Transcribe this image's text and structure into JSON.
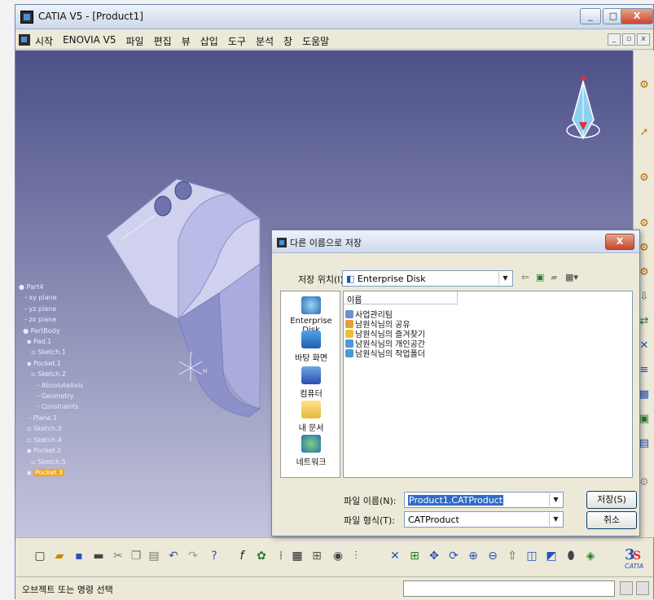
{
  "window": {
    "title": "CATIA V5 - [Product1]",
    "controls": {
      "minimize": "_",
      "maximize": "□",
      "close": "X"
    }
  },
  "menu": {
    "items": [
      "시작",
      "ENOVIA V5",
      "파일",
      "편집",
      "뷰",
      "삽입",
      "도구",
      "분석",
      "창",
      "도움말"
    ],
    "mdi_controls": [
      "_",
      "▫",
      "x"
    ]
  },
  "tree": {
    "nodes": [
      "Part4",
      "xy plane",
      "yz plane",
      "zx plane",
      "PartBody",
      "Pad.1",
      "Sketch.1",
      "Pocket.1",
      "Sketch.2",
      "AbsoluteAxis",
      "Geometry",
      "Constraints",
      "Plane.1",
      "Sketch.3",
      "Sketch.4",
      "Pocket.2",
      "Sketch.5",
      "Pocket.3"
    ]
  },
  "compass": {
    "label": ""
  },
  "dialog": {
    "title": "다른 이름으로 저장",
    "close": "X",
    "location_label": "저장 위치(I):",
    "location_value": "Enterprise Disk",
    "nav_icons": [
      "back-icon",
      "up-folder-icon",
      "new-folder-icon",
      "view-menu-icon"
    ],
    "places": [
      "Enterprise Disk",
      "바탕 화면",
      "컴퓨터",
      "내 문서",
      "네트워크"
    ],
    "column_header": "이름",
    "files": [
      "사업관리팀",
      "남원식님의 공유",
      "남원식님의 즐겨찾기",
      "남원식님의 개인공간",
      "남원식님의 작업폴더"
    ],
    "filename_label": "파일 이름(N):",
    "filename_value": "Product1.CATProduct",
    "filetype_label": "파일 형식(T):",
    "filetype_value": "CATProduct",
    "save_button": "저장(S)",
    "cancel_button": "취소"
  },
  "status": {
    "text": "오브젝트 또는 명령 선택"
  },
  "brand": {
    "logo_text": "CATIA"
  },
  "colors": {
    "viewport_top": "#4d5088",
    "viewport_bottom": "#c3c4dc",
    "selection": "#316ac5",
    "tree_highlight": "#f2a516"
  }
}
